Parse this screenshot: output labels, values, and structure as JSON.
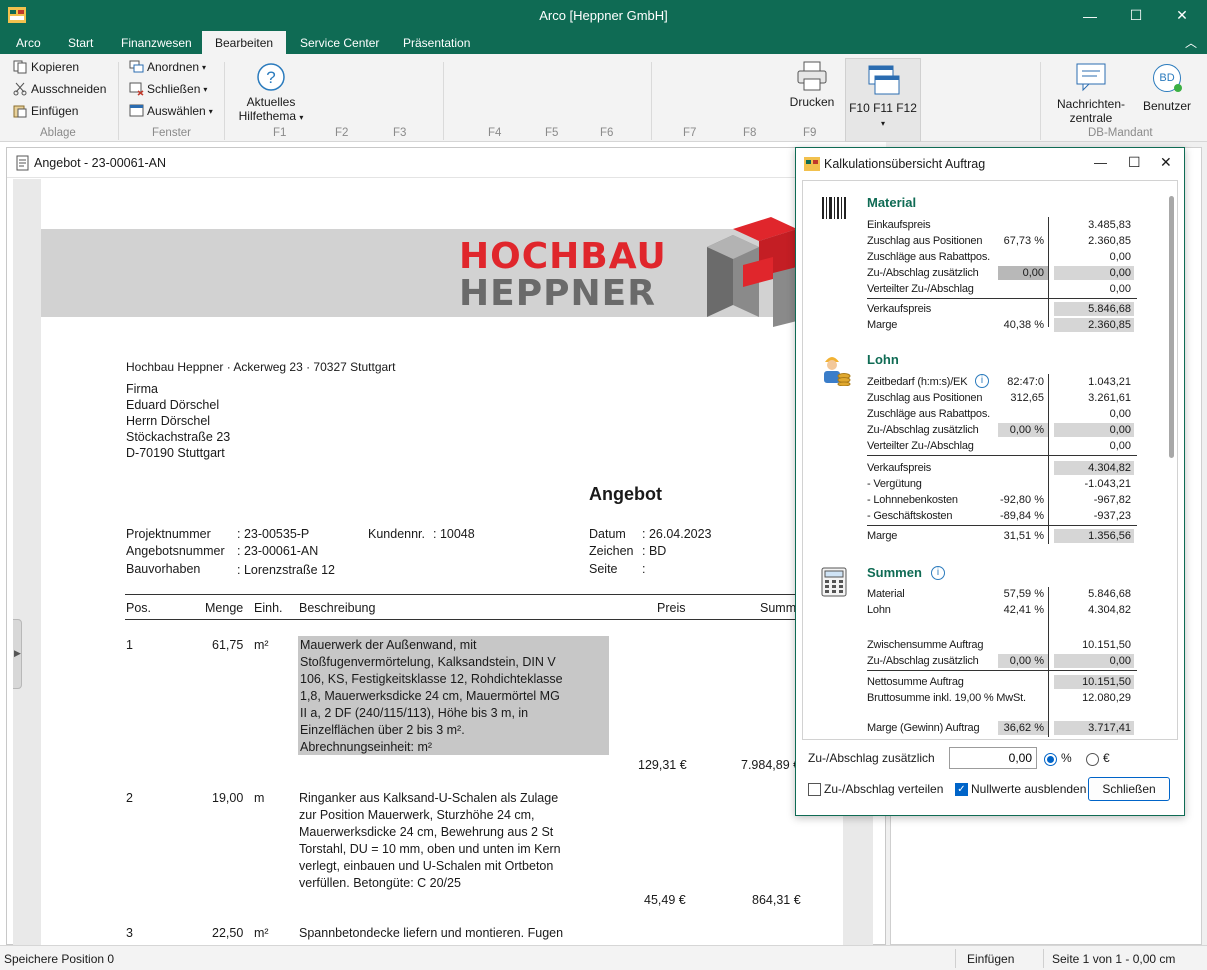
{
  "window": {
    "title": "Arco [Heppner GmbH]",
    "minimize": "—",
    "maximize": "☐",
    "close": "✕"
  },
  "tabs": [
    "Arco",
    "Start",
    "Finanzwesen",
    "Bearbeiten",
    "Service Center",
    "Präsentation"
  ],
  "tabs_active": "Bearbeiten",
  "ribbon": {
    "ablage": {
      "kopieren": "Kopieren",
      "ausschneiden": "Ausschneiden",
      "einfuegen": "Einfügen",
      "label": "Ablage"
    },
    "fenster": {
      "anordnen": "Anordnen",
      "schliessen": "Schließen",
      "auswaehlen": "Auswählen",
      "label": "Fenster"
    },
    "hilfe": {
      "line1": "Aktuelles",
      "line2": "Hilfethema"
    },
    "fkeys": [
      "F1",
      "F2",
      "F3",
      "F4",
      "F5",
      "F6",
      "F7",
      "F8",
      "F9"
    ],
    "drucken": "Drucken",
    "f10": "F10 F11 F12",
    "nachrichten1": "Nachrichten-",
    "nachrichten2": "zentrale",
    "benutzer": "Benutzer",
    "benutzer_initials": "BD",
    "db_mandant": "DB-Mandant"
  },
  "doc": {
    "title": "Angebot - 23-00061-AN",
    "logo_line1": "HOCHBAU",
    "logo_line2": "HEPPNER",
    "sender": "Hochbau Heppner · Ackerweg 23 · 70327 Stuttgart",
    "address": [
      "Firma",
      "Eduard Dörschel",
      "Herrn Dörschel",
      "Stöckachstraße 23",
      "D-70190 Stuttgart"
    ],
    "heading": "Angebot",
    "meta_left": [
      {
        "label": "Projektnummer",
        "value": ": 23-00535-P"
      },
      {
        "label": "Angebotsnummer",
        "value": ": 23-00061-AN"
      },
      {
        "label": "Bauvorhaben",
        "value": ": Lorenzstraße 12"
      }
    ],
    "kundennr_label": "Kundennr.",
    "kundennr_value": ": 10048",
    "meta_right": [
      {
        "label": "Datum",
        "value": ": 26.04.2023"
      },
      {
        "label": "Zeichen",
        "value": ": BD"
      },
      {
        "label": "Seite",
        "value": ":"
      }
    ],
    "columns": {
      "pos": "Pos.",
      "menge": "Menge",
      "einh": "Einh.",
      "beschreibung": "Beschreibung",
      "preis": "Preis",
      "summe": "Summe"
    },
    "positions": [
      {
        "pos": "1",
        "menge": "61,75",
        "einh": "m²",
        "lines": [
          "Mauerwerk der Außenwand, mit",
          "Stoßfugenvermörtelung, Kalksandstein, DIN V",
          "106, KS, Festigkeitsklasse 12, Rohdichteklasse",
          "1,8, Mauerwerksdicke 24 cm, Mauermörtel MG",
          "II a, 2 DF (240/115/113), Höhe bis 3 m, in",
          "Einzelflächen über 2 bis 3 m².",
          "Abrechnungseinheit: m²"
        ],
        "preis": "129,31 €",
        "summe": "7.984,89 €"
      },
      {
        "pos": "2",
        "menge": "19,00",
        "einh": "m",
        "lines": [
          "Ringanker aus Kalksand-U-Schalen als Zulage",
          "zur Position Mauerwerk, Sturzhöhe 24 cm,",
          "Mauerwerksdicke 24 cm, Bewehrung aus 2 St",
          "Torstahl, DU = 10 mm, oben und unten im Kern",
          "verlegt, einbauen und U-Schalen mit Ortbeton",
          "verfüllen. Betongüte: C 20/25"
        ],
        "preis": "45,49 €",
        "summe": "864,31 €"
      },
      {
        "pos": "3",
        "menge": "22,50",
        "einh": "m²",
        "lines": [
          "Spannbetondecke liefern und montieren. Fugen"
        ],
        "preis": "",
        "summe": ""
      }
    ]
  },
  "kalk": {
    "title": "Kalkulationsübersicht Auftrag",
    "material": {
      "title": "Material",
      "rows": [
        {
          "label": "Einkaufspreis",
          "pct": "",
          "val": "3.485,83"
        },
        {
          "label": "Zuschlag aus Positionen",
          "pct": "67,73 %",
          "val": "2.360,85"
        },
        {
          "label": "Zuschläge aus Rabattpos.",
          "pct": "",
          "val": "0,00"
        },
        {
          "label": "Zu-/Abschlag zusätzlich",
          "pct": "0,00",
          "val": "0,00"
        },
        {
          "label": "Verteilter Zu-/Abschlag",
          "pct": "",
          "val": "0,00"
        },
        {
          "label": "Verkaufspreis",
          "pct": "",
          "val": "5.846,68"
        },
        {
          "label": "Marge",
          "pct": "40,38 %",
          "val": "2.360,85"
        }
      ]
    },
    "lohn": {
      "title": "Lohn",
      "rows": [
        {
          "label": "Zeitbedarf (h:m:s)/EK",
          "pct": "82:47:0",
          "val": "1.043,21"
        },
        {
          "label": "Zuschlag aus Positionen",
          "pct": "312,65",
          "val": "3.261,61"
        },
        {
          "label": "Zuschläge aus Rabattpos.",
          "pct": "",
          "val": "0,00"
        },
        {
          "label": "Zu-/Abschlag zusätzlich",
          "pct": "0,00 %",
          "val": "0,00"
        },
        {
          "label": "Verteilter Zu-/Abschlag",
          "pct": "",
          "val": "0,00"
        },
        {
          "label": "Verkaufspreis",
          "pct": "",
          "val": "4.304,82"
        },
        {
          "label": " - Vergütung",
          "pct": "",
          "val": "-1.043,21"
        },
        {
          "label": " - Lohnnebenkosten",
          "pct": "-92,80 %",
          "val": "-967,82"
        },
        {
          "label": " - Geschäftskosten",
          "pct": "-89,84 %",
          "val": "-937,23"
        },
        {
          "label": "Marge",
          "pct": "31,51 %",
          "val": "1.356,56"
        }
      ]
    },
    "summen": {
      "title": "Summen",
      "rows": [
        {
          "label": "Material",
          "pct": "57,59 %",
          "val": "5.846,68"
        },
        {
          "label": "Lohn",
          "pct": "42,41 %",
          "val": "4.304,82"
        },
        {
          "label": "Zwischensumme Auftrag",
          "pct": "",
          "val": "10.151,50"
        },
        {
          "label": "Zu-/Abschlag zusätzlich",
          "pct": "0,00 %",
          "val": "0,00"
        },
        {
          "label": "Nettosumme Auftrag",
          "pct": "",
          "val": "10.151,50"
        },
        {
          "label": "Bruttosumme inkl. 19,00 % MwSt.",
          "pct": "",
          "val": "12.080,29"
        },
        {
          "label": "Marge (Gewinn) Auftrag",
          "pct": "36,62 %",
          "val": "3.717,41"
        }
      ]
    },
    "footer": {
      "zuschlag_label": "Zu-/Abschlag zusätzlich",
      "zuschlag_value": "0,00",
      "pct_label": "%",
      "eur_label": "€",
      "verteilen_label": "Zu-/Abschlag verteilen",
      "nullwerte_label": "Nullwerte ausblenden",
      "schliessen_label": "Schließen"
    }
  },
  "status": {
    "left": "Speichere Position 0",
    "mode": "Einfügen",
    "page": "Seite 1 von 1 - 0,00 cm"
  },
  "colors": {
    "accent": "#0f6b54",
    "logo_red": "#e0262c",
    "logo_gray": "#6a6a6a"
  }
}
